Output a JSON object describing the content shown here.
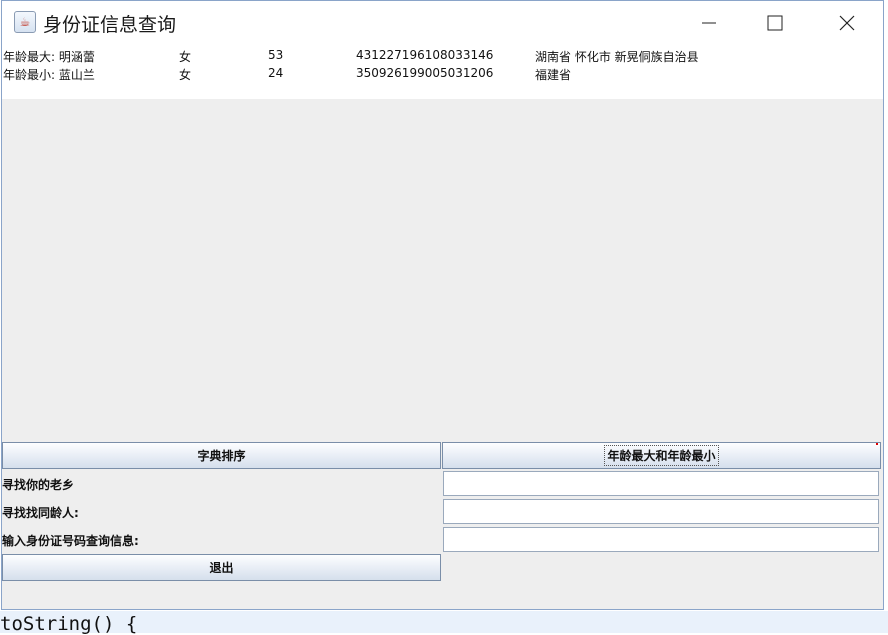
{
  "window": {
    "title": "身份证信息查询"
  },
  "info": {
    "oldest": {
      "label": "年龄最大:",
      "name": "明涵蕾",
      "gender": "女",
      "age": "53",
      "id_number": "431227196108033146",
      "address": "湖南省 怀化市 新晃侗族自治县"
    },
    "youngest": {
      "label": "年龄最小:",
      "name": "蓝山兰",
      "gender": "女",
      "age": "24",
      "id_number": "350926199005031206",
      "address": "福建省"
    }
  },
  "buttons": {
    "sort": "字典排序",
    "age_extremes": "年龄最大和年龄最小",
    "exit": "退出"
  },
  "fields": {
    "hometown_label": "寻找你的老乡",
    "hometown_value": "",
    "same_age_label": "寻找找同龄人:",
    "same_age_value": "",
    "id_query_label": "输入身份证号码查询信息:",
    "id_query_value": ""
  },
  "background_code": "toString() {"
}
